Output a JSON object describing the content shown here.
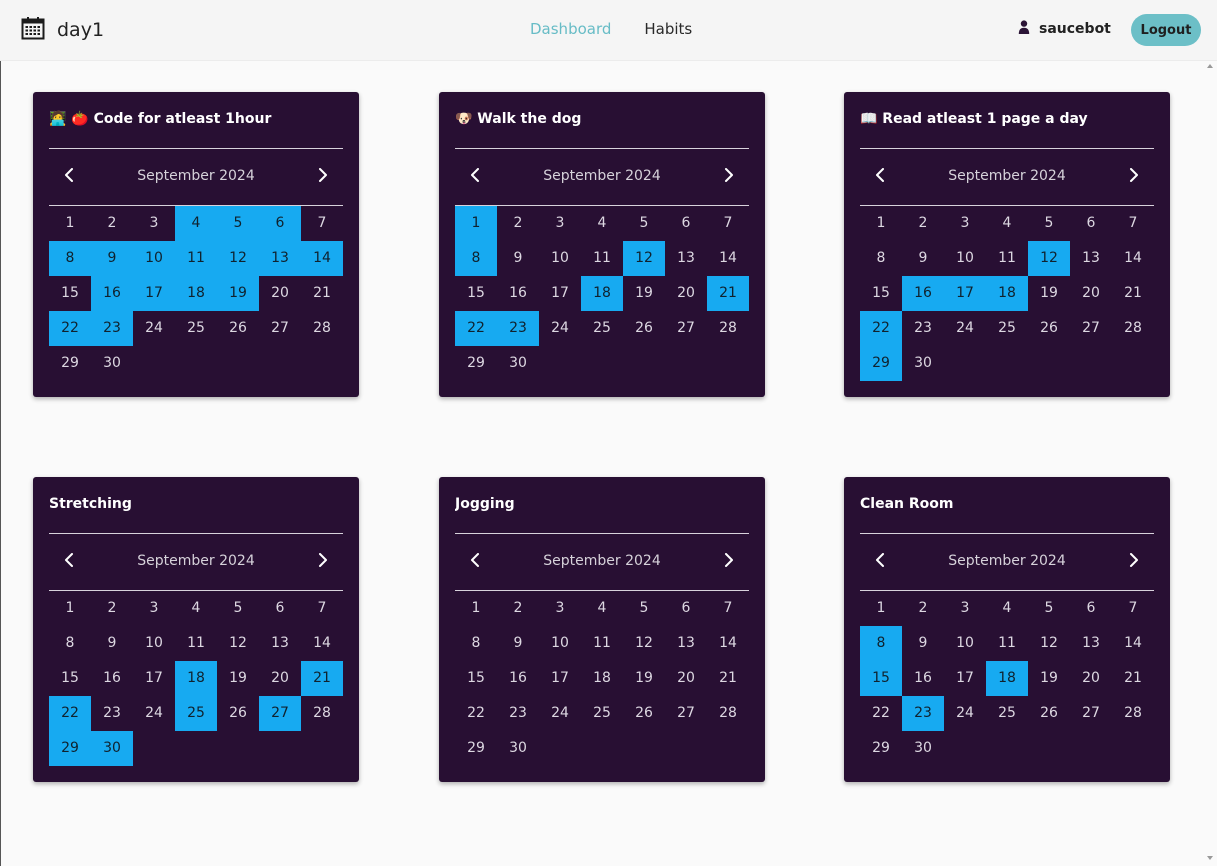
{
  "app": {
    "title": "day1",
    "brand_icon": "calendar-icon"
  },
  "nav": {
    "links": [
      {
        "label": "Dashboard",
        "active": true
      },
      {
        "label": "Habits",
        "active": false
      }
    ]
  },
  "user": {
    "name": "saucebot",
    "icon": "user-icon"
  },
  "logout_label": "Logout",
  "colors": {
    "card_bg": "#280f33",
    "highlight": "#17aaf1",
    "accent": "#6cbfc7"
  },
  "cards": [
    {
      "title": "🧑‍💻 🍅 Code for atleast 1hour",
      "month": "September 2024",
      "days": [
        1,
        2,
        3,
        4,
        5,
        6,
        7,
        8,
        9,
        10,
        11,
        12,
        13,
        14,
        15,
        16,
        17,
        18,
        19,
        20,
        21,
        22,
        23,
        24,
        25,
        26,
        27,
        28,
        29,
        30
      ],
      "checked": [
        4,
        5,
        6,
        8,
        9,
        10,
        11,
        12,
        13,
        14,
        16,
        17,
        18,
        19,
        22,
        23
      ]
    },
    {
      "title": "🐶 Walk the dog",
      "month": "September 2024",
      "days": [
        1,
        2,
        3,
        4,
        5,
        6,
        7,
        8,
        9,
        10,
        11,
        12,
        13,
        14,
        15,
        16,
        17,
        18,
        19,
        20,
        21,
        22,
        23,
        24,
        25,
        26,
        27,
        28,
        29,
        30
      ],
      "checked": [
        1,
        8,
        12,
        18,
        21,
        22,
        23
      ]
    },
    {
      "title": "📖 Read atleast 1 page a day",
      "month": "September 2024",
      "days": [
        1,
        2,
        3,
        4,
        5,
        6,
        7,
        8,
        9,
        10,
        11,
        12,
        13,
        14,
        15,
        16,
        17,
        18,
        19,
        20,
        21,
        22,
        23,
        24,
        25,
        26,
        27,
        28,
        29,
        30
      ],
      "checked": [
        12,
        16,
        17,
        18,
        22,
        29
      ]
    },
    {
      "title": "Stretching",
      "month": "September 2024",
      "days": [
        1,
        2,
        3,
        4,
        5,
        6,
        7,
        8,
        9,
        10,
        11,
        12,
        13,
        14,
        15,
        16,
        17,
        18,
        19,
        20,
        21,
        22,
        23,
        24,
        25,
        26,
        27,
        28,
        29,
        30
      ],
      "checked": [
        18,
        21,
        22,
        25,
        27,
        29,
        30
      ]
    },
    {
      "title": "Jogging",
      "month": "September 2024",
      "days": [
        1,
        2,
        3,
        4,
        5,
        6,
        7,
        8,
        9,
        10,
        11,
        12,
        13,
        14,
        15,
        16,
        17,
        18,
        19,
        20,
        21,
        22,
        23,
        24,
        25,
        26,
        27,
        28,
        29,
        30
      ],
      "checked": []
    },
    {
      "title": "Clean Room",
      "month": "September 2024",
      "days": [
        1,
        2,
        3,
        4,
        5,
        6,
        7,
        8,
        9,
        10,
        11,
        12,
        13,
        14,
        15,
        16,
        17,
        18,
        19,
        20,
        21,
        22,
        23,
        24,
        25,
        26,
        27,
        28,
        29,
        30
      ],
      "checked": [
        8,
        15,
        18,
        23
      ]
    }
  ]
}
